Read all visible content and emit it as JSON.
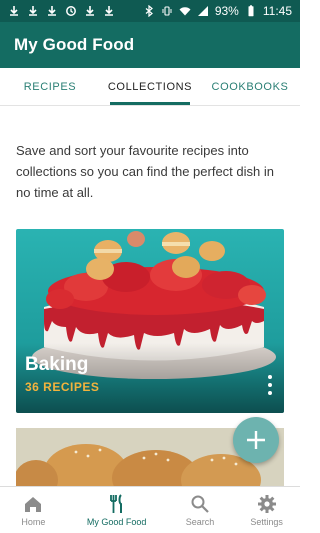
{
  "status_bar": {
    "battery": "93%",
    "time": "11:45",
    "left_icons": [
      "download-icon",
      "download-icon",
      "download-icon",
      "sync-icon",
      "download-icon",
      "download-icon"
    ],
    "right_icons": [
      "bluetooth-icon",
      "vibrate-icon",
      "wifi-icon",
      "signal-icon",
      "battery-icon"
    ]
  },
  "app_bar": {
    "title": "My Good Food"
  },
  "tabs": [
    {
      "label": "RECIPES",
      "active": false
    },
    {
      "label": "COLLECTIONS",
      "active": true
    },
    {
      "label": "COOKBOOKS",
      "active": false
    }
  ],
  "intro_text": "Save and sort your favourite recipes into collections so you can find the perfect dish in no time at all.",
  "collections": [
    {
      "title": "Baking",
      "count": "36 RECIPES"
    }
  ],
  "fab": {
    "icon": "plus-icon"
  },
  "bottom_nav": [
    {
      "label": "Home",
      "icon": "home-icon",
      "active": false
    },
    {
      "label": "My Good Food",
      "icon": "cutlery-icon",
      "active": true
    },
    {
      "label": "Search",
      "icon": "search-icon",
      "active": false
    },
    {
      "label": "Settings",
      "icon": "gear-icon",
      "active": false
    }
  ],
  "colors": {
    "status_bar": "#0f5a52",
    "app_bar": "#146c62",
    "accent": "#146c62",
    "count_text": "#f2b33d",
    "fab": "#6db3af"
  }
}
